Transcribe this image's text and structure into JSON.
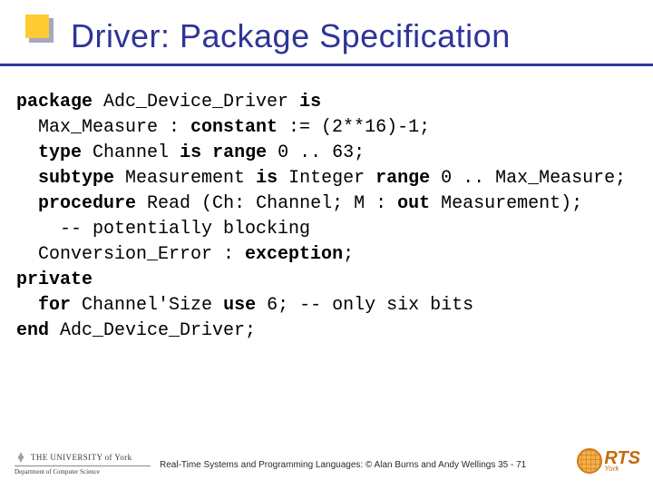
{
  "title": "Driver: Package Specification",
  "code": {
    "l1a": "package",
    "l1b": " Adc_Device_Driver ",
    "l1c": "is",
    "l2a": "  Max_Measure : ",
    "l2b": "constant",
    "l2c": " := (2**16)-1;",
    "l3a": "  ",
    "l3b": "type",
    "l3c": " Channel ",
    "l3d": "is range",
    "l3e": " 0 .. 63;",
    "l4a": "  ",
    "l4b": "subtype",
    "l4c": " Measurement ",
    "l4d": "is",
    "l4e": " Integer ",
    "l4f": "range",
    "l4g": " 0 .. Max_Measure;",
    "l5a": "  ",
    "l5b": "procedure",
    "l5c": " Read (Ch: Channel; M : ",
    "l5d": "out",
    "l5e": " Measurement);",
    "l6": "    -- potentially blocking",
    "l7a": "  Conversion_Error : ",
    "l7b": "exception",
    "l7c": ";",
    "l8": "private",
    "l9a": "  ",
    "l9b": "for",
    "l9c": " Channel'Size ",
    "l9d": "use",
    "l9e": " 6; -- only six bits",
    "l10a": "end",
    "l10b": " Adc_Device_Driver;"
  },
  "footer": {
    "uoy_line1": "THE UNIVERSITY of York",
    "uoy_line2": "Department of Computer Science",
    "caption": "Real-Time Systems and Programming Languages: © Alan Burns and Andy Wellings  35 - 71",
    "rts": "RTS",
    "rts_sub": "York"
  }
}
